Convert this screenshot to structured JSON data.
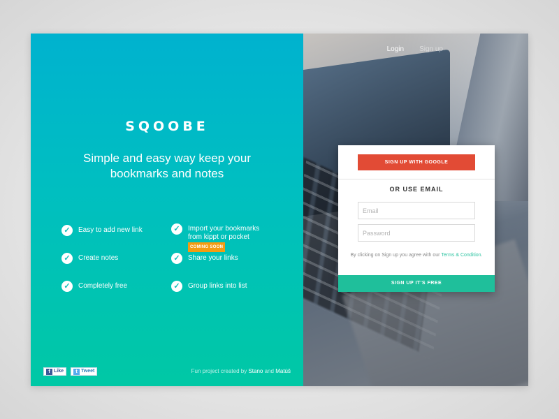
{
  "brand": {
    "logo": "SQOOBE"
  },
  "hero": {
    "tagline": "Simple and easy way keep your bookmarks and notes"
  },
  "features": [
    {
      "label": "Easy to add new link"
    },
    {
      "label": "Import your bookmarks from kippt or pocket",
      "badge": "COMING SOON"
    },
    {
      "label": "Create notes"
    },
    {
      "label": "Share your links"
    },
    {
      "label": "Completely free"
    },
    {
      "label": "Group links into list"
    }
  ],
  "social": {
    "facebook_label": "Like",
    "twitter_label": "Tweet"
  },
  "credits": {
    "prefix": "Fun project created by",
    "author1": "Stano",
    "and": "and",
    "author2": "Matúš"
  },
  "nav": {
    "login": "Login",
    "signup": "Sign up"
  },
  "signup_card": {
    "google_button": "SIGN UP WITH GOOGLE",
    "or_label": "OR USE EMAIL",
    "email_placeholder": "Email",
    "password_placeholder": "Password",
    "agree_text": "By clicking on Sign up you agree with our",
    "terms_link": "Terms & Condition",
    "submit_button": "SIGN UP IT'S FREE"
  },
  "colors": {
    "gradient_top": "#00b2cf",
    "gradient_bottom": "#00c8a5",
    "google_red": "#e24b35",
    "submit_green": "#1fbf9b",
    "badge_orange": "#f39c12"
  },
  "icons": [
    "check-icon",
    "facebook-icon",
    "twitter-icon"
  ]
}
